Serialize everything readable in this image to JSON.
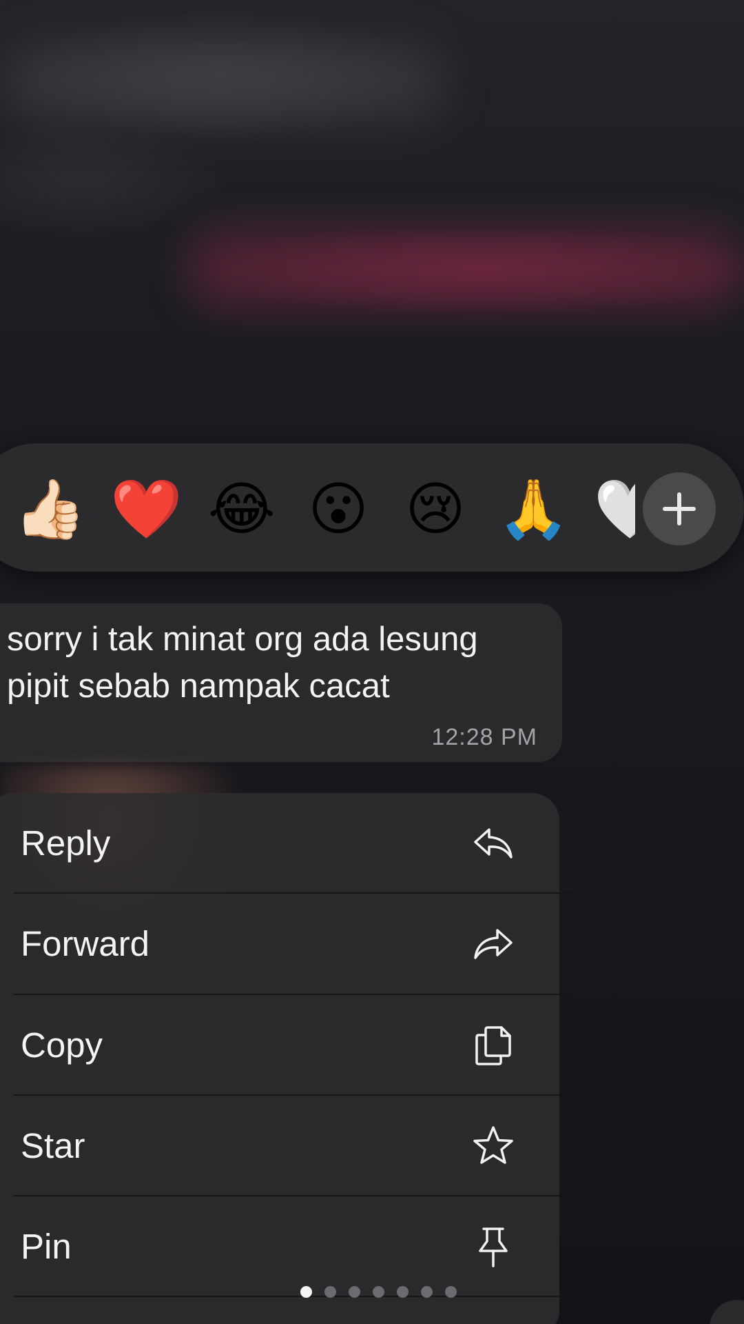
{
  "reactions": {
    "items": [
      {
        "emoji": "👍🏻",
        "name": "thumbs-up"
      },
      {
        "emoji": "❤️",
        "name": "red-heart"
      },
      {
        "emoji": "😂",
        "name": "tears-of-joy"
      },
      {
        "emoji": "😮",
        "name": "surprised"
      },
      {
        "emoji": "😢",
        "name": "crying"
      },
      {
        "emoji": "🙏",
        "name": "folded-hands"
      },
      {
        "emoji": "🤍",
        "name": "white-heart"
      }
    ],
    "more_icon": "plus-icon"
  },
  "message": {
    "text": "sorry i tak minat org ada lesung\npipit sebab nampak cacat",
    "time": "12:28 PM"
  },
  "menu": {
    "items": [
      {
        "label": "Reply",
        "icon": "reply-icon"
      },
      {
        "label": "Forward",
        "icon": "forward-icon"
      },
      {
        "label": "Copy",
        "icon": "copy-icon"
      },
      {
        "label": "Star",
        "icon": "star-icon"
      },
      {
        "label": "Pin",
        "icon": "pin-icon"
      }
    ]
  },
  "pagination": {
    "total": 7,
    "active": 1
  },
  "colors": {
    "menu_background": "#2e2c2f",
    "bubble_background": "#2a2a2d",
    "reaction_bar": "#2b2b2e",
    "text": "#f4f4f4",
    "timestamp": "#a4a4a8"
  }
}
